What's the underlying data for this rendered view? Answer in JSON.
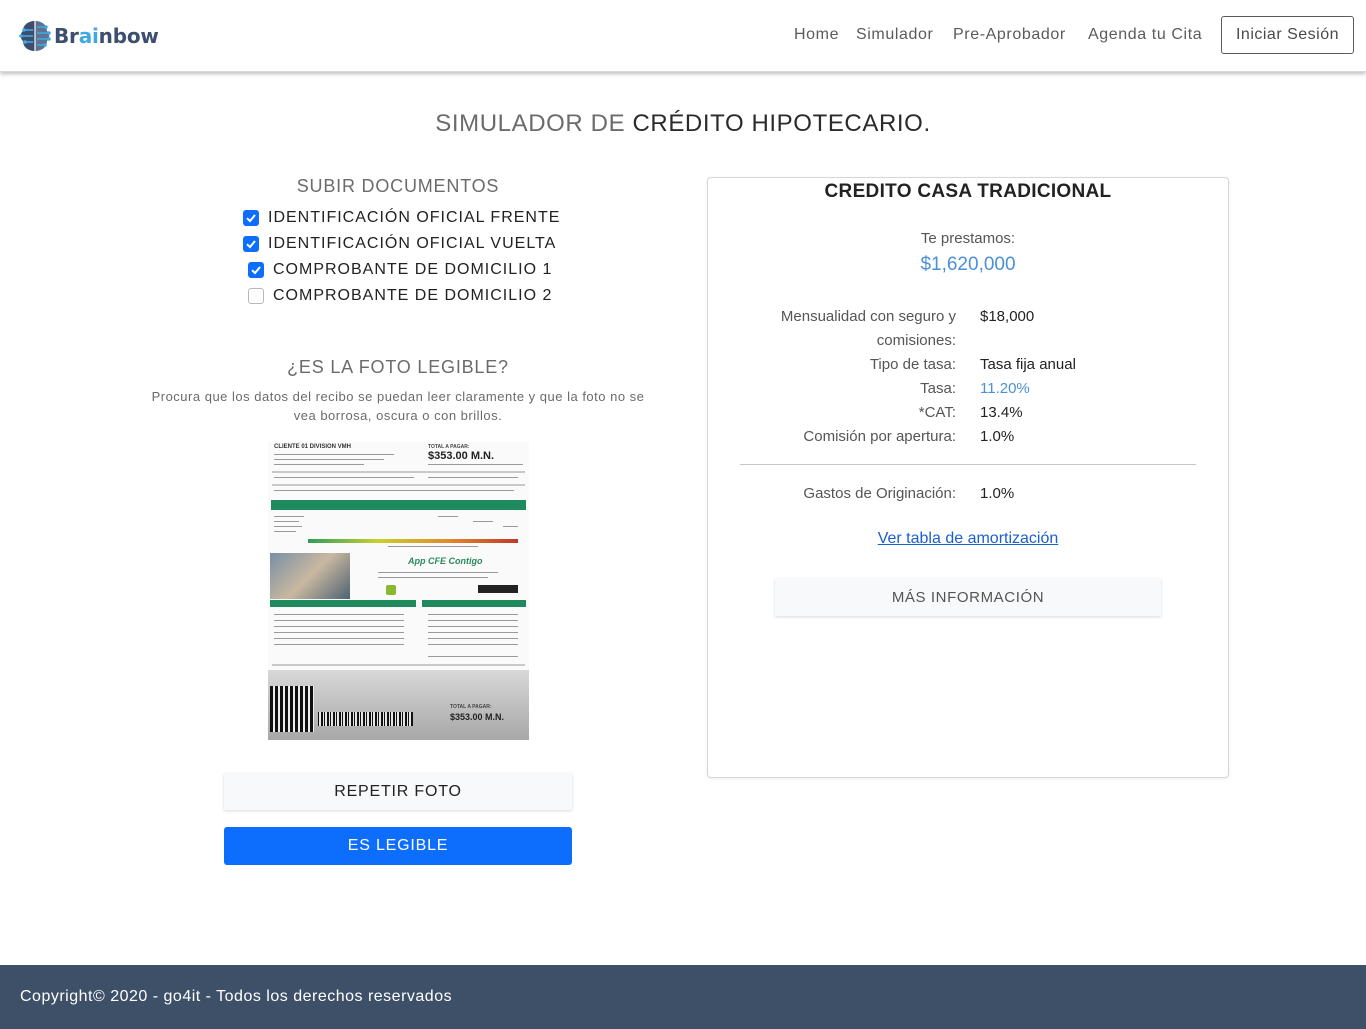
{
  "brand": {
    "prefix": "Br",
    "accent": "ai",
    "suffix": "nbow"
  },
  "nav": {
    "links": [
      "Home",
      "Simulador",
      "Pre-Aprobador",
      "Agenda tu Cita"
    ],
    "login_label": "Iniciar Sesión"
  },
  "page": {
    "title_light": "SIMULADOR DE ",
    "title_dark": "CRÉDITO HIPOTECARIO."
  },
  "documents": {
    "heading": "SUBIR DOCUMENTOS",
    "items": [
      {
        "label": "IDENTIFICACIÓN OFICIAL FRENTE",
        "checked": true
      },
      {
        "label": "IDENTIFICACIÓN OFICIAL VUELTA",
        "checked": true
      },
      {
        "label": "COMPROBANTE DE DOMICILIO 1",
        "checked": true
      },
      {
        "label": "COMPROBANTE DE DOMICILIO 2",
        "checked": false
      }
    ]
  },
  "legibility": {
    "heading": "¿ES LA FOTO LEGIBLE?",
    "hint": "Procura que los datos del recibo se puedan leer claramente y que la foto no se vea borrosa, oscura o con brillos.",
    "repeat_label": "REPETIR FOTO",
    "confirm_label": "ES LEGIBLE"
  },
  "receipt": {
    "customer": "CLIENTE 01 DIVISION VMH",
    "total_label": "TOTAL A PAGAR:",
    "total": "$353.00 M.N.",
    "app_title": "App CFE Contigo",
    "bottom_total_label": "TOTAL A PAGAR:",
    "bottom_total": "$353.00 M.N."
  },
  "credit": {
    "title": "CREDITO CASA TRADICIONAL",
    "lend_label": "Te prestamos:",
    "lend_amount": "$1,620,000",
    "monthly_label_1": "Mensualidad con seguro y",
    "monthly_label_2": "comisiones:",
    "monthly_value": "$18,000",
    "rate_type_label": "Tipo de tasa:",
    "rate_type_value": "Tasa fija anual",
    "rate_label": "Tasa:",
    "rate_value": "11.20%",
    "cat_label": "*CAT:",
    "cat_value": "13.4%",
    "opening_fee_label": "Comisión por apertura:",
    "opening_fee_value": "1.0%",
    "origination_label": "Gastos de Originación:",
    "origination_value": "1.0%",
    "amortization_link": "Ver tabla de amortización",
    "more_info_label": "MÁS INFORMACIÓN"
  },
  "footer": {
    "text": "Copyright© 2020 - go4it - Todos los derechos reservados"
  },
  "colors": {
    "primary": "#0d6efd",
    "footer": "#3d5068",
    "accent_blue": "#4a90d9",
    "brand_dark": "#3d4f6e"
  }
}
